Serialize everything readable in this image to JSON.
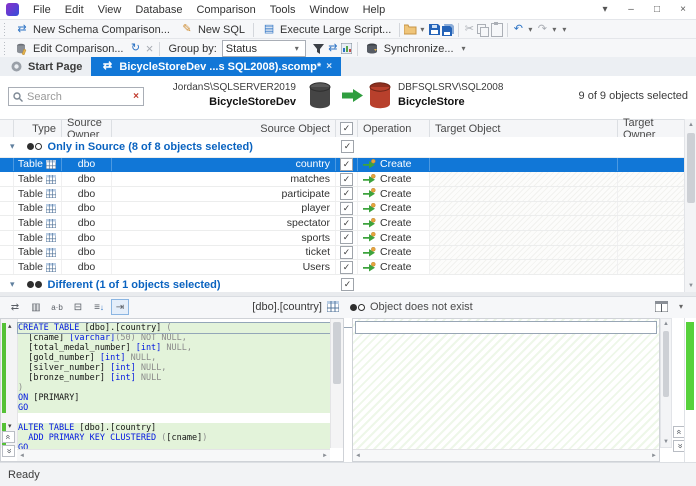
{
  "menu_bar": {
    "items": [
      "File",
      "Edit",
      "View",
      "Database",
      "Comparison",
      "Tools",
      "Window",
      "Help"
    ]
  },
  "toolbar_main": {
    "new_schema_comparison_label": "New Schema Comparison...",
    "new_sql_label": "New SQL",
    "execute_large_script_label": "Execute Large Script..."
  },
  "toolbar_comparison": {
    "edit_comparison_label": "Edit Comparison...",
    "group_by_label": "Group by:",
    "group_by_value": "Status",
    "synchronize_label": "Synchronize..."
  },
  "tab_bar": {
    "start_page_label": "Start Page",
    "active_tab_label": "BicycleStoreDev ...s SQL2008).scomp*"
  },
  "comparison_header": {
    "search_placeholder": "Search",
    "source": {
      "server": "JordanS\\SQLSERVER2019",
      "database": "BicycleStoreDev"
    },
    "target": {
      "server": "DBFSQLSRV\\SQL2008",
      "database": "BicycleStore"
    },
    "selection_summary": "9 of 9 objects selected"
  },
  "grid": {
    "header": {
      "type": "Type",
      "source_owner": "Source Owner",
      "source_object": "Source Object",
      "operation": "Operation",
      "target_object": "Target Object",
      "target_owner": "Target Owner"
    },
    "groups": [
      {
        "label": "Only in Source (8 of 8 objects selected)",
        "status": "only-in-source",
        "checked": true,
        "rows": [
          {
            "type": "Table",
            "owner": "dbo",
            "name": "country",
            "operation": "Create",
            "checked": true,
            "selected": true
          },
          {
            "type": "Table",
            "owner": "dbo",
            "name": "matches",
            "operation": "Create",
            "checked": true,
            "selected": false
          },
          {
            "type": "Table",
            "owner": "dbo",
            "name": "participate",
            "operation": "Create",
            "checked": true,
            "selected": false
          },
          {
            "type": "Table",
            "owner": "dbo",
            "name": "player",
            "operation": "Create",
            "checked": true,
            "selected": false
          },
          {
            "type": "Table",
            "owner": "dbo",
            "name": "spectator",
            "operation": "Create",
            "checked": true,
            "selected": false
          },
          {
            "type": "Table",
            "owner": "dbo",
            "name": "sports",
            "operation": "Create",
            "checked": true,
            "selected": false
          },
          {
            "type": "Table",
            "owner": "dbo",
            "name": "ticket",
            "operation": "Create",
            "checked": true,
            "selected": false
          },
          {
            "type": "Table",
            "owner": "dbo",
            "name": "Users",
            "operation": "Create",
            "checked": true,
            "selected": false
          }
        ]
      },
      {
        "label": "Different (1 of 1 objects selected)",
        "status": "different",
        "checked": true,
        "rows": []
      }
    ]
  },
  "detail_pane": {
    "object_label": "[dbo].[country]",
    "status_text": "Object does not exist",
    "sql_lines": [
      {
        "block": 1,
        "current": true,
        "fold": "up",
        "tokens": [
          [
            "kw",
            "CREATE TABLE"
          ],
          [
            "id",
            " [dbo].[country] "
          ],
          [
            "gr",
            "("
          ]
        ]
      },
      {
        "block": 1,
        "tokens": [
          [
            "id",
            "  [cname] "
          ],
          [
            "ty",
            "[varchar]"
          ],
          [
            "gr",
            "(50)"
          ],
          [
            "gr",
            " NOT NULL,"
          ]
        ]
      },
      {
        "block": 1,
        "tokens": [
          [
            "id",
            "  [total_medal_number] "
          ],
          [
            "ty",
            "[int]"
          ],
          [
            "gr",
            " NULL,"
          ]
        ]
      },
      {
        "block": 1,
        "tokens": [
          [
            "id",
            "  [gold_number] "
          ],
          [
            "ty",
            "[int]"
          ],
          [
            "gr",
            " NULL,"
          ]
        ]
      },
      {
        "block": 1,
        "tokens": [
          [
            "id",
            "  [silver_number] "
          ],
          [
            "ty",
            "[int]"
          ],
          [
            "gr",
            " NULL,"
          ]
        ]
      },
      {
        "block": 1,
        "tokens": [
          [
            "id",
            "  [bronze_number] "
          ],
          [
            "ty",
            "[int]"
          ],
          [
            "gr",
            " NULL"
          ]
        ]
      },
      {
        "block": 1,
        "tokens": [
          [
            "gr",
            ")"
          ]
        ]
      },
      {
        "block": 1,
        "tokens": [
          [
            "kw",
            "ON"
          ],
          [
            "id",
            " [PRIMARY]"
          ]
        ]
      },
      {
        "block": 1,
        "tokens": [
          [
            "kw",
            "GO"
          ]
        ]
      },
      {
        "block": 0,
        "tokens": []
      },
      {
        "block": 2,
        "fold": "down",
        "tokens": [
          [
            "kw",
            "ALTER TABLE"
          ],
          [
            "id",
            " [dbo].[country]"
          ]
        ]
      },
      {
        "block": 2,
        "tokens": [
          [
            "kw",
            "  ADD PRIMARY KEY CLUSTERED "
          ],
          [
            "gr",
            "("
          ],
          [
            "id",
            "[cname]"
          ],
          [
            "gr",
            ")"
          ]
        ]
      },
      {
        "block": 2,
        "tokens": [
          [
            "kw",
            "GO"
          ]
        ]
      }
    ]
  },
  "status_bar": {
    "text": "Ready"
  },
  "icons": {
    "overflow": "▾",
    "minimize": "–",
    "maximize": "□",
    "close": "×",
    "undo": "↶",
    "redo": "↷",
    "refresh": "↻",
    "cancel_refresh": "×",
    "cut": "✂",
    "swap_arrows": "⇄",
    "chevron_down": "▾",
    "check": "✓",
    "search_clear": "×",
    "tab_close": "×"
  },
  "colors": {
    "accent_blue": "#1177d7",
    "group_label_blue": "#0a63c0",
    "create_arrow_green": "#3da33d",
    "change_bar_green": "#55c136",
    "overview_ruler_green": "#57d13b",
    "diff_line_green": "#e3f3da",
    "source_db_icon": "#4a4a4a",
    "target_db_icon": "#b8402c"
  }
}
